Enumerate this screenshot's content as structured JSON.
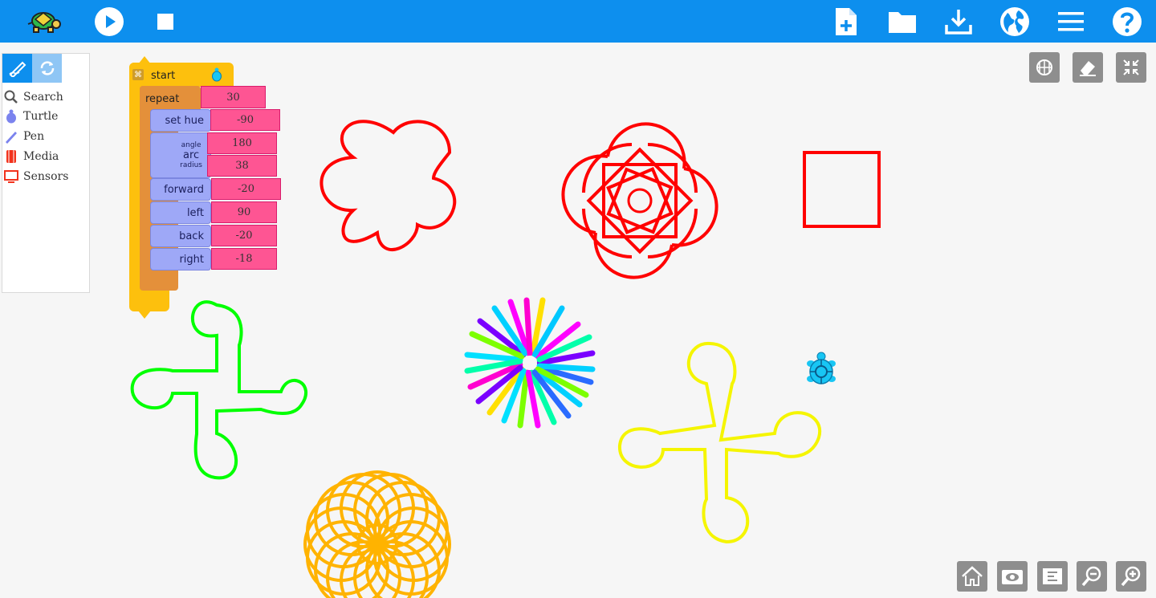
{
  "toolbar": {
    "logo_icon": "turtle-logo-icon",
    "left_buttons": [
      "play-icon",
      "stop-icon"
    ],
    "right_buttons": [
      "new-project-icon",
      "open-folder-icon",
      "save-download-icon",
      "language-globe-icon",
      "menu-icon",
      "help-icon"
    ],
    "background": "#0d8fee"
  },
  "palette": {
    "tabs": [
      "pen-draw-icon",
      "refresh-icon"
    ],
    "items": [
      {
        "label": "Search",
        "icon": "search-icon",
        "color": "#555555"
      },
      {
        "label": "Turtle",
        "icon": "turtle-icon",
        "color": "#7b83ee"
      },
      {
        "label": "Pen",
        "icon": "pen-icon",
        "color": "#7b83ee"
      },
      {
        "label": "Media",
        "icon": "media-icon",
        "color": "#f2331d"
      },
      {
        "label": "Sensors",
        "icon": "sensors-icon",
        "color": "#f2331d"
      }
    ]
  },
  "program": {
    "start_label": "start",
    "repeat_label": "repeat",
    "repeat_count": "30",
    "commands": [
      {
        "label": "set hue",
        "args": [
          "-90"
        ]
      },
      {
        "label": "arc",
        "sub_labels": [
          "angle",
          "radius"
        ],
        "args": [
          "180",
          "38"
        ]
      },
      {
        "label": "forward",
        "args": [
          "-20"
        ]
      },
      {
        "label": "left",
        "args": [
          "90"
        ]
      },
      {
        "label": "back",
        "args": [
          "-20"
        ]
      },
      {
        "label": "right",
        "args": [
          "-18"
        ]
      }
    ],
    "colors": {
      "start": "#fdc00d",
      "repeat": "#e4903a",
      "turtle_cmd": "#9ea8f7",
      "number": "#fe5593"
    }
  },
  "canvas_controls": {
    "top_right": [
      "grid-icon",
      "eraser-icon",
      "collapse-icon"
    ],
    "bottom_right": [
      "home-icon",
      "show-hide-blocks-icon",
      "clean-blocks-icon",
      "zoom-out-icon",
      "zoom-in-icon"
    ]
  },
  "drawings": [
    {
      "name": "flower",
      "color": "#ff0000"
    },
    {
      "name": "square-star-rosette",
      "color": "#ff0000"
    },
    {
      "name": "square",
      "color": "#ff0000"
    },
    {
      "name": "green-pinwheel",
      "color": "#00ff00"
    },
    {
      "name": "rainbow-burst",
      "color": "multicolor"
    },
    {
      "name": "yellow-pinwheel",
      "color": "#f5f500"
    },
    {
      "name": "orange-spirograph",
      "color": "#ffb300"
    }
  ]
}
